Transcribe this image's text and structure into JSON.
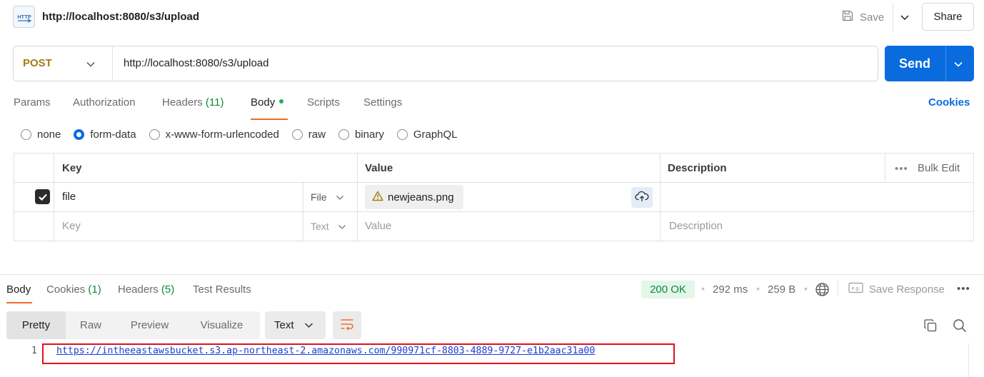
{
  "titlebar": {
    "badge_text": "HTTP",
    "title": "http://localhost:8080/s3/upload",
    "save_label": "Save",
    "share_label": "Share"
  },
  "request": {
    "method": "POST",
    "url": "http://localhost:8080/s3/upload",
    "send_label": "Send",
    "tabs": [
      {
        "label": "Params"
      },
      {
        "label": "Authorization"
      },
      {
        "label": "Headers",
        "count": "(11)"
      },
      {
        "label": "Body",
        "active": true
      },
      {
        "label": "Scripts"
      },
      {
        "label": "Settings"
      }
    ],
    "cookies_label": "Cookies",
    "body_types": [
      "none",
      "form-data",
      "x-www-form-urlencoded",
      "raw",
      "binary",
      "GraphQL"
    ],
    "selected_body_type": "form-data"
  },
  "form_table": {
    "headers": {
      "key": "Key",
      "value": "Value",
      "description": "Description",
      "bulk_edit": "Bulk Edit"
    },
    "rows": [
      {
        "checked": true,
        "key": "file",
        "type": "File",
        "value": "newjeans.png",
        "value_warning": true,
        "description": ""
      }
    ],
    "new_row": {
      "key_placeholder": "Key",
      "type": "Text",
      "value_placeholder": "Value",
      "description_placeholder": "Description"
    }
  },
  "response": {
    "tabs": [
      {
        "label": "Body",
        "active": true
      },
      {
        "label": "Cookies",
        "count": "(1)"
      },
      {
        "label": "Headers",
        "count": "(5)"
      },
      {
        "label": "Test Results"
      }
    ],
    "status": "200 OK",
    "time": "292 ms",
    "size": "259 B",
    "save_response_label": "Save Response",
    "view_modes": [
      "Pretty",
      "Raw",
      "Preview",
      "Visualize"
    ],
    "active_view": "Pretty",
    "format": "Text",
    "lines": [
      {
        "number": "1",
        "text": "https://intheeastawsbucket.s3.ap-northeast-2.amazonaws.com/990971cf-8803-4889-9727-e1b2aac31a00"
      }
    ]
  },
  "colors": {
    "accent": "#0a6bdf",
    "method": "#a57c15",
    "success": "#0d8a3a",
    "tab_underline": "#ef6c2b",
    "highlight_border": "#e0111d"
  }
}
